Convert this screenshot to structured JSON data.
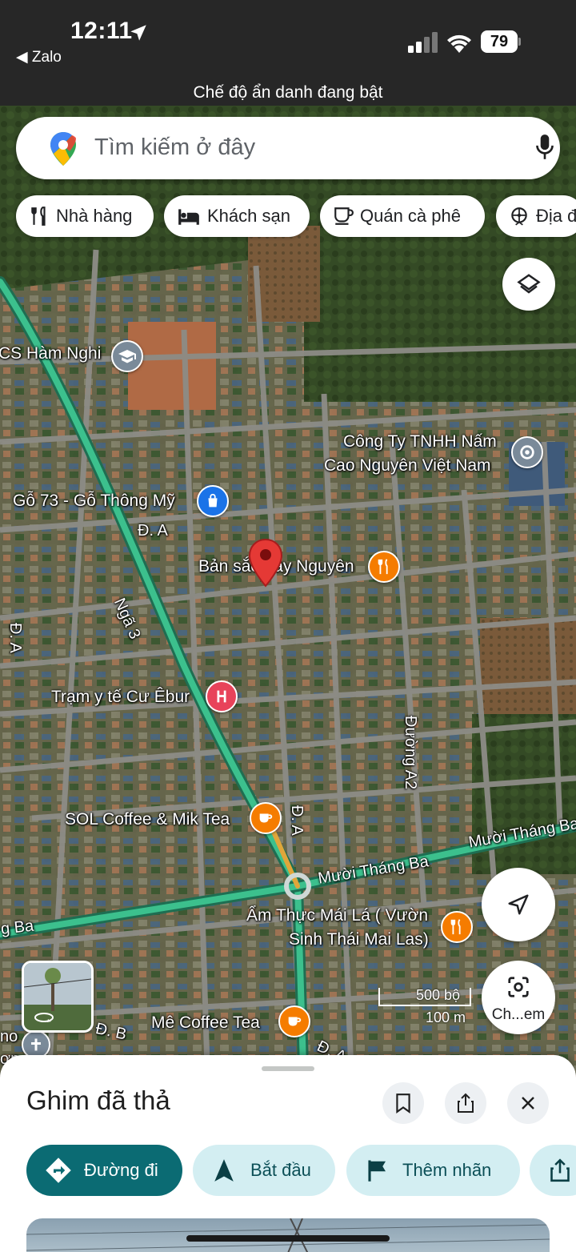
{
  "status_bar": {
    "time": "12:11",
    "back_app": "◀ Zalo",
    "battery": "79"
  },
  "incognito_banner": "Chế độ ẩn danh đang bật",
  "search": {
    "placeholder": "Tìm kiếm ở đây"
  },
  "categories": [
    {
      "label": "Nhà hàng",
      "icon": "restaurant-icon"
    },
    {
      "label": "Khách sạn",
      "icon": "hotel-icon"
    },
    {
      "label": "Quán cà phê",
      "icon": "coffee-icon"
    },
    {
      "label": "Địa đ",
      "icon": "attraction-icon"
    }
  ],
  "map": {
    "labels": {
      "school": "CS Hàm Nghi",
      "company_line1": "Công Ty TNHH Nấm",
      "company_line2": "Cao Nguyên Việt Nam",
      "wood": "Gỗ 73 - Gỗ Thông Mỹ",
      "road_da_1": "Đ. A",
      "road_nga3": "Ngã 3",
      "restaurant1": "Bản sắc Tây Nguyên",
      "road_da_2": "Đ. A",
      "clinic": "Trạm y tế Cư Êbur",
      "road_a2": "Đường A2",
      "coffee1": "SOL Coffee & Mik Tea",
      "road_da_3": "Đ. A",
      "road_muoi_thang_ba_1": "Mười Tháng Ba",
      "road_muoi_thang_ba_2": "Mười Tháng Ba",
      "road_ba": "g Ba",
      "restaurant2_line1": "Ẩm Thực Mái Lá ( Vườn",
      "restaurant2_line2": "Sinh Thái Mai Las)",
      "coffee2": "Mê Coffee Tea",
      "road_db": "Đ. B",
      "road_da_4": "Đ. A",
      "edge_left_1": "no",
      "edge_left_2": "ơn"
    },
    "scale_ft": "500 bộ",
    "scale_m": "100 m",
    "lens_label": "Ch...em"
  },
  "sheet": {
    "title": "Ghim đã thả",
    "actions": [
      {
        "label": "Đường đi",
        "icon": "directions-icon"
      },
      {
        "label": "Bắt đầu",
        "icon": "navigation-arrow-icon"
      },
      {
        "label": "Thêm nhãn",
        "icon": "flag-icon"
      },
      {
        "label": "",
        "icon": "share-icon"
      }
    ]
  },
  "colors": {
    "primary": "#0b6b73",
    "secondary_bg": "#d3eef2",
    "pin_red": "#e53935",
    "poi_orange": "#f57c00",
    "poi_education": "#7a8a99",
    "poi_shopping": "#1a73e8",
    "poi_medical": "#e8435a",
    "highway_green": "#3cc08d"
  }
}
